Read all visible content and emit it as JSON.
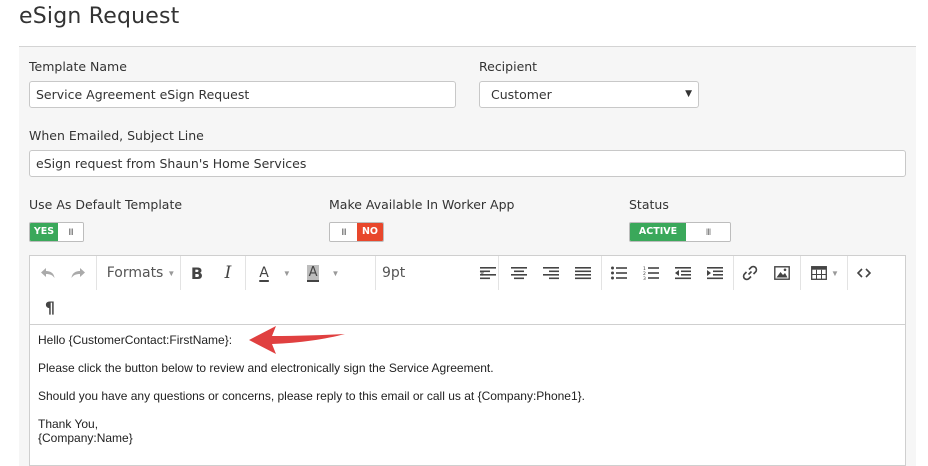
{
  "page": {
    "title": "eSign Request"
  },
  "form": {
    "template_name": {
      "label": "Template Name",
      "value": "Service Agreement eSign Request"
    },
    "recipient": {
      "label": "Recipient",
      "value": "Customer"
    },
    "subject": {
      "label": "When Emailed, Subject Line",
      "value": "eSign request from Shaun's Home Services"
    },
    "default_template": {
      "label": "Use As Default Template",
      "state_label": "YES"
    },
    "worker_app": {
      "label": "Make Available In Worker App",
      "state_label": "NO"
    },
    "status": {
      "label": "Status",
      "state_label": "ACTIVE"
    }
  },
  "toolbar": {
    "formats_label": "Formats",
    "font_size": "9pt",
    "font_color_letter": "A",
    "bg_color_letter": "A",
    "bold_letter": "B",
    "italic_letter": "I",
    "paragraph_glyph": "¶"
  },
  "editor": {
    "lines": [
      "Hello {CustomerContact:FirstName}:",
      "Please click the button below to review and electronically sign the Service Agreement.",
      "Should you have any questions or concerns, please reply to this email or call us at {Company:Phone1}.",
      "Thank You,",
      "{Company:Name}"
    ]
  },
  "colors": {
    "toggle_on": "#3aa85a",
    "toggle_off": "#e8472c",
    "annotation_arrow": "#e04040"
  }
}
